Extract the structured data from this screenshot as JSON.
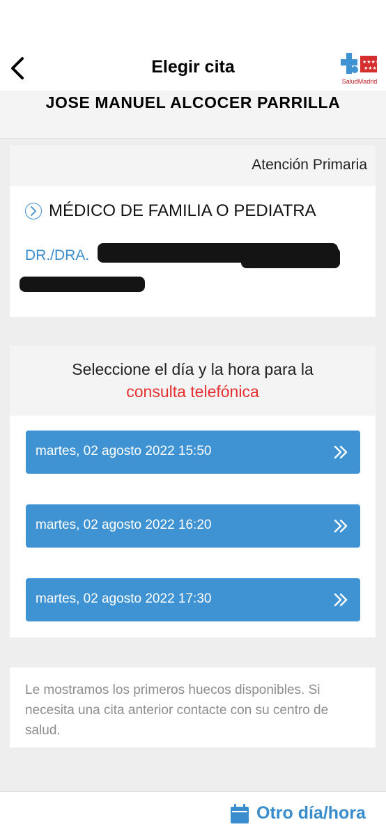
{
  "header": {
    "title": "Elegir cita",
    "logo_text": "SaludMadrid"
  },
  "patient": {
    "name": "JOSE MANUEL ALCOCER PARRILLA"
  },
  "doctor_card": {
    "specialty": "Atención Primaria",
    "service": "MÉDICO DE FAMILIA O PEDIATRA",
    "doctor_prefix": "DR./DRA."
  },
  "selection": {
    "line1": "Seleccione el día y la hora para la",
    "line2": "consulta telefónica",
    "slots": [
      {
        "label": "martes, 02 agosto 2022 15:50"
      },
      {
        "label": "martes, 02 agosto 2022 16:20"
      },
      {
        "label": "martes, 02 agosto 2022 17:30"
      }
    ]
  },
  "info": {
    "text": "Le mostramos los primeros huecos disponibles. Si necesita una cita anterior contacte con su centro de salud."
  },
  "bottom": {
    "other_label": "Otro día/hora"
  },
  "colors": {
    "accent_blue": "#3f93d2",
    "link_blue": "#3a8dcc",
    "red": "#e5302f",
    "background": "#efeeee"
  },
  "icons": {
    "back": "chevron-left-icon",
    "logo": "salud-madrid-logo",
    "service": "circle-chevron-right-icon",
    "slot": "double-chevron-right-icon",
    "calendar": "calendar-icon"
  }
}
